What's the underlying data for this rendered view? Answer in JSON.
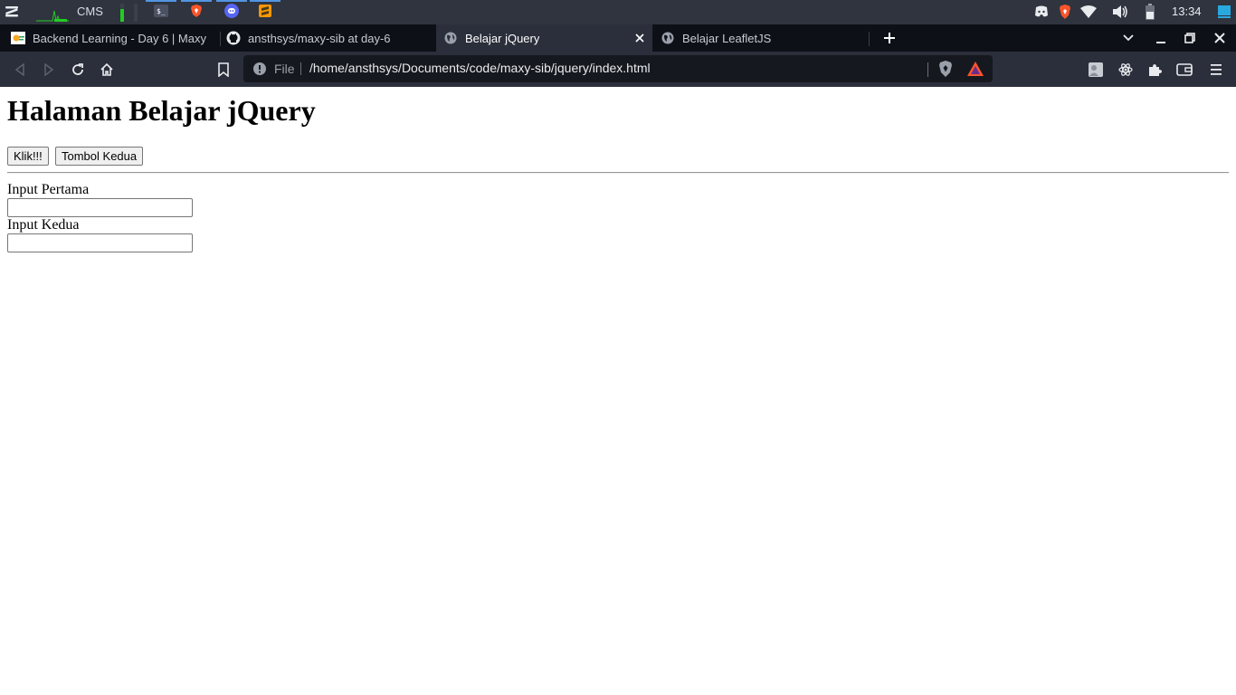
{
  "system_panel": {
    "workspace_label": "CMS",
    "clock": "13:34",
    "cpu_meter_percent": 70,
    "taskbar_apps": [
      "terminal-icon",
      "brave-icon",
      "discord-icon",
      "sublime-text-icon"
    ],
    "tray_icons": [
      "discord-icon",
      "brave-icon",
      "wifi-icon",
      "volume-icon",
      "battery-icon",
      "notification-icon"
    ]
  },
  "browser": {
    "tabs": [
      {
        "title": "Backend Learning - Day 6 | Maxy",
        "favicon": "maxy-logo-icon",
        "active": false
      },
      {
        "title": "ansthsys/maxy-sib at day-6",
        "favicon": "github-icon",
        "active": false
      },
      {
        "title": "Belajar jQuery",
        "favicon": "globe-icon",
        "active": true
      },
      {
        "title": "Belajar LeafletJS",
        "favicon": "globe-icon",
        "active": false
      }
    ],
    "address_bar": {
      "scheme_label": "File",
      "url": "/home/ansthsys/Documents/code/maxy-sib/jquery/index.html"
    },
    "colors": {
      "frame": "#0e1018",
      "toolbar": "#2b2f3b",
      "brave_orange": "#fb542b"
    }
  },
  "page": {
    "heading": "Halaman Belajar jQuery",
    "buttons": {
      "first": "Klik!!!",
      "second": "Tombol Kedua"
    },
    "inputs": [
      {
        "label": "Input Pertama",
        "value": ""
      },
      {
        "label": "Input Kedua",
        "value": ""
      }
    ]
  }
}
